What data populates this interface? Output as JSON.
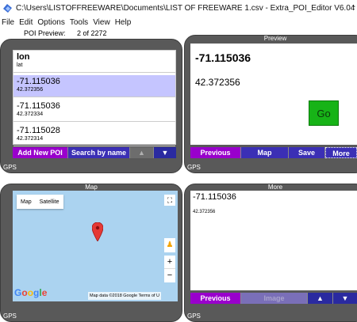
{
  "window": {
    "title": "C:\\Users\\LISTOFFREEWARE\\Documents\\LIST OF FREEWARE 1.csv - Extra_POI_Editor V6.04",
    "minimize": "-"
  },
  "menu": [
    "File",
    "Edit",
    "Options",
    "Tools",
    "View",
    "Help"
  ],
  "poi_preview": {
    "label": "POI Preview:",
    "count": "2  of  2272"
  },
  "list_panel": {
    "header": {
      "lon": "lon",
      "lat": "lat"
    },
    "items": [
      {
        "lon": "-71.115036",
        "lat": "42.372356"
      },
      {
        "lon": "-71.115036",
        "lat": "42.372334"
      },
      {
        "lon": "-71.115028",
        "lat": "42.372314"
      }
    ],
    "buttons": {
      "add": "Add New POI",
      "search": "Search by name",
      "up": "▲",
      "down": "▼"
    },
    "status": "GPS"
  },
  "preview_panel": {
    "title": "Preview",
    "lon": "-71.115036",
    "lat": "42.372356",
    "go": "Go",
    "buttons": {
      "previous": "Previous",
      "map": "Map",
      "save": "Save",
      "more": "More"
    },
    "status": "GPS"
  },
  "map_panel": {
    "title": "Map",
    "map_label": "Map",
    "satellite_label": "Satellite",
    "fullscreen": "⛶",
    "pegman": "♟",
    "zoom_in": "+",
    "zoom_out": "−",
    "google": [
      "G",
      "o",
      "o",
      "g",
      "l",
      "e"
    ],
    "credit": "Map data ©2018 Google   Terms of U",
    "status": "GPS"
  },
  "more_panel": {
    "title": "More",
    "lon": "-71.115036",
    "lat": "42.372356",
    "buttons": {
      "previous": "Previous",
      "image": "Image",
      "up": "▲",
      "down": "▼"
    },
    "status": "GPS"
  },
  "colors": {
    "purple": "#9900cc",
    "blue": "#3b2fb5",
    "panel": "#595959",
    "selected": "#c5c5ff",
    "map": "#abd3f0"
  }
}
